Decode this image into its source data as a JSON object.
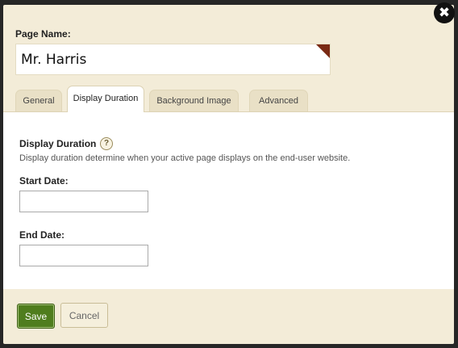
{
  "dialog": {
    "close_glyph": "✖",
    "page_name_label": "Page Name:",
    "page_name_value": "Mr. Harris"
  },
  "tabs": [
    {
      "label": "General",
      "active": false
    },
    {
      "label": "Display Duration",
      "active": true
    },
    {
      "label": "Background Image",
      "active": false
    },
    {
      "label": "Advanced",
      "active": false
    }
  ],
  "section": {
    "title": "Display Duration",
    "help_glyph": "?",
    "description": "Display duration determine when your active page displays on the end-user website."
  },
  "fields": {
    "start_date_label": "Start Date:",
    "start_date_value": "",
    "end_date_label": "End Date:",
    "end_date_value": ""
  },
  "buttons": {
    "save_label": "Save",
    "cancel_label": "Cancel"
  },
  "icons": {
    "close": "close-icon",
    "help": "help-icon",
    "corner": "corner-flag-icon"
  },
  "colors": {
    "save_button": "#4f7d1e",
    "panel_bg": "#f3ecd8",
    "corner_flag": "#7a2a13"
  }
}
